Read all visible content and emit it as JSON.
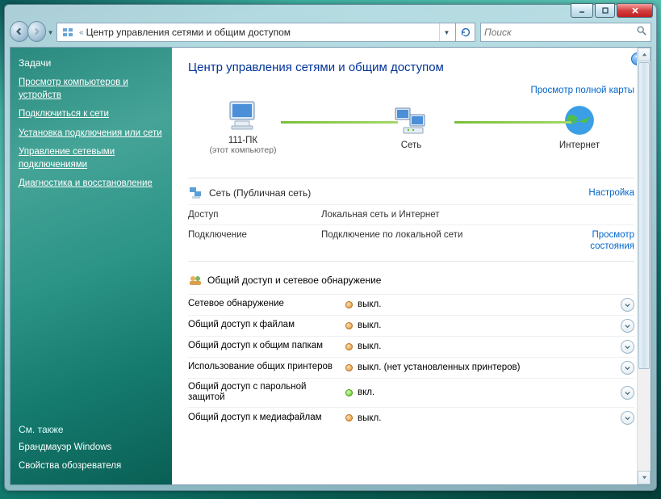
{
  "window": {
    "breadcrumb_prefix": "«",
    "breadcrumb": "Центр управления сетями и общим доступом",
    "search_placeholder": "Поиск"
  },
  "sidebar": {
    "heading": "Задачи",
    "links": [
      "Просмотр компьютеров и устройств",
      "Подключиться к сети",
      "Установка подключения или сети",
      "Управление сетевыми подключениями",
      "Диагностика и восстановление"
    ],
    "see_also_heading": "См. также",
    "see_also": [
      "Брандмауэр Windows",
      "Свойства обозревателя"
    ]
  },
  "main": {
    "title": "Центр управления сетями и общим доступом",
    "view_full_map": "Просмотр полной карты",
    "nodes": {
      "pc_name": "111-ПК",
      "pc_sub": "(этот компьютер)",
      "network": "Сеть",
      "internet": "Интернет"
    },
    "network": {
      "name": "Сеть (Публичная сеть)",
      "configure": "Настройка",
      "rows": [
        {
          "label": "Доступ",
          "value": "Локальная сеть и Интернет",
          "action": ""
        },
        {
          "label": "Подключение",
          "value": "Подключение по локальной сети",
          "action": "Просмотр состояния"
        }
      ]
    },
    "sharing": {
      "heading": "Общий доступ и сетевое обнаружение",
      "items": [
        {
          "label": "Сетевое обнаружение",
          "state": "off",
          "value": "выкл."
        },
        {
          "label": "Общий доступ к файлам",
          "state": "off",
          "value": "выкл."
        },
        {
          "label": "Общий доступ к общим папкам",
          "state": "off",
          "value": "выкл."
        },
        {
          "label": "Использование общих принтеров",
          "state": "off",
          "value": "выкл. (нет установленных принтеров)"
        },
        {
          "label": "Общий доступ с парольной защитой",
          "state": "on",
          "value": "вкл."
        },
        {
          "label": "Общий доступ к медиафайлам",
          "state": "off",
          "value": "выкл."
        }
      ]
    }
  }
}
